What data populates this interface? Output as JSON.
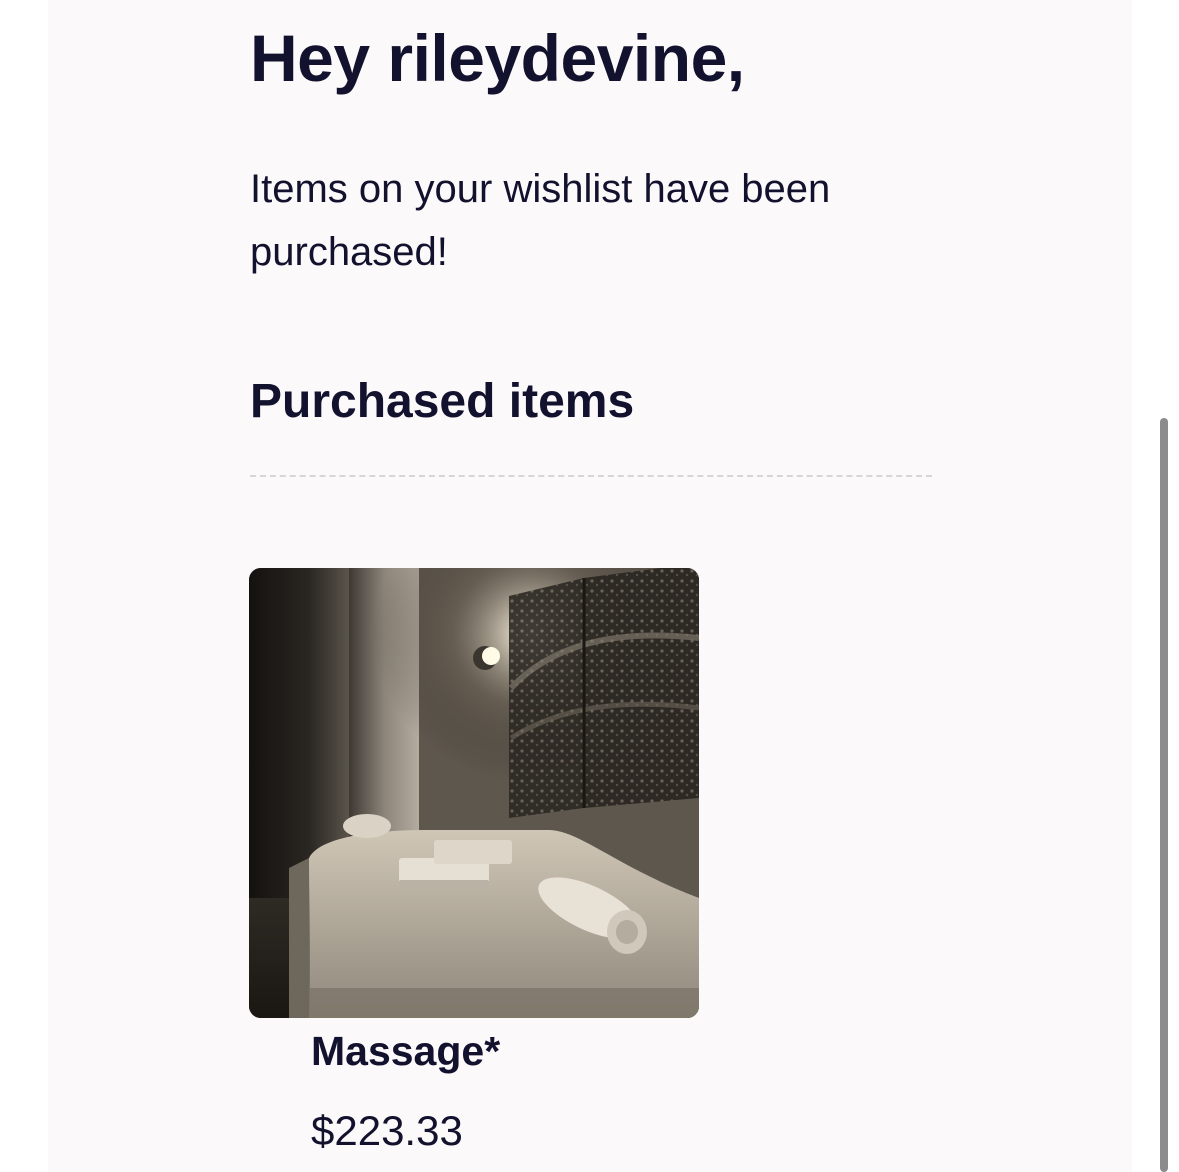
{
  "email": {
    "greeting": "Hey rileydevine,",
    "message": "Items on your wishlist have been purchased!",
    "section_title": "Purchased items"
  },
  "purchased_items": [
    {
      "name": "Massage*",
      "price": "$223.33",
      "image_icon": "massage-room-photo"
    }
  ],
  "colors": {
    "text": "#12112e",
    "panel_background": "#fbf9f9",
    "divider": "#d7d5d5",
    "scrollbar": "#8c8c8c"
  }
}
